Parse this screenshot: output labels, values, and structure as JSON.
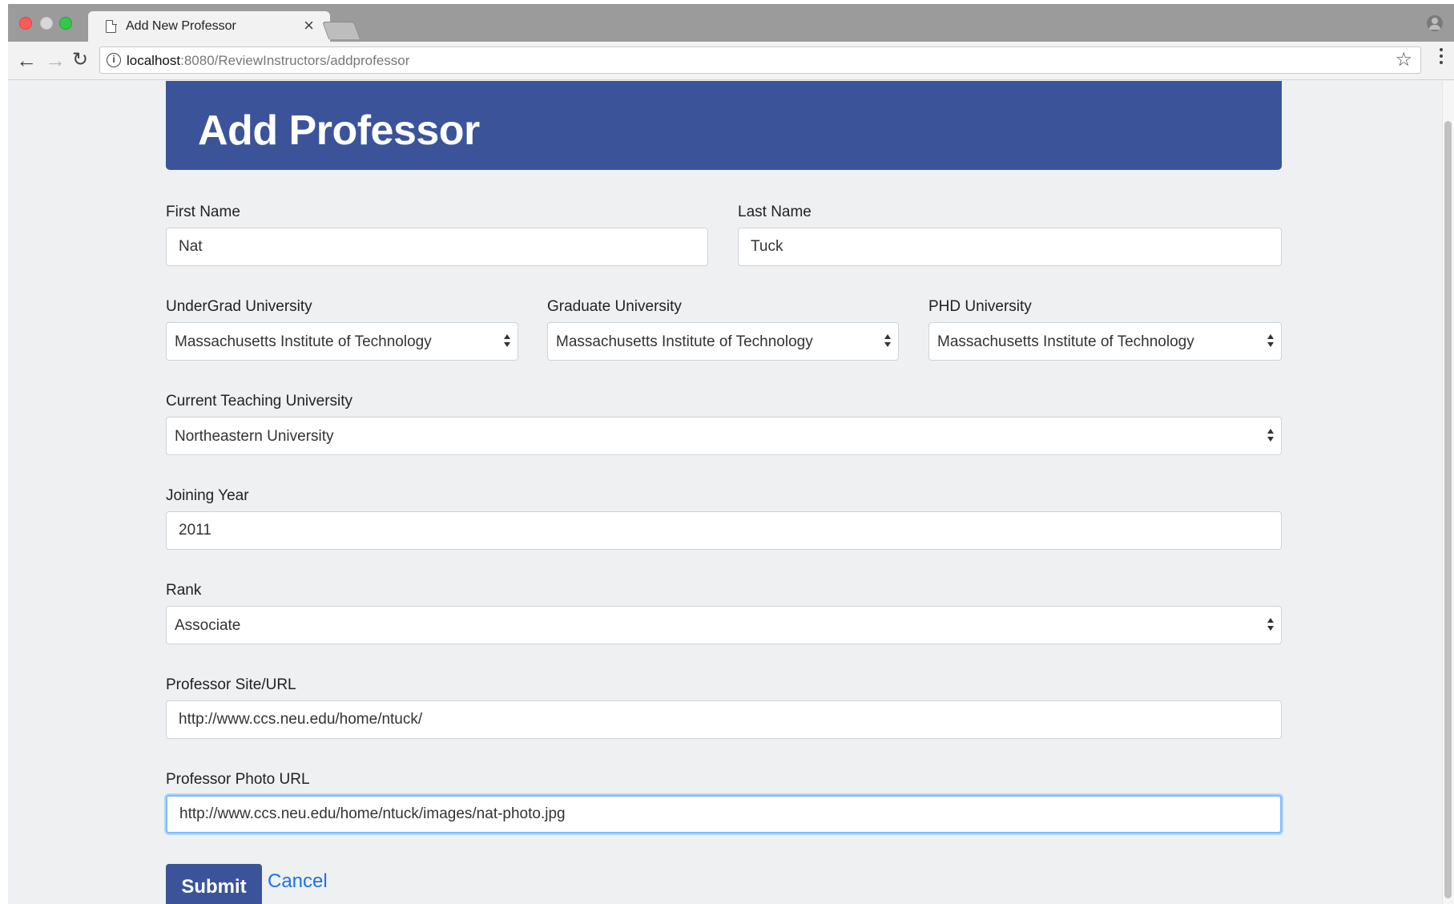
{
  "browser": {
    "tab_title": "Add New Professor",
    "tab_close": "×",
    "url_host": "localhost",
    "url_rest": ":8080/ReviewInstructors/addprofessor"
  },
  "page": {
    "heading": "Add Professor"
  },
  "form": {
    "first_name": {
      "label": "First Name",
      "value": "Nat"
    },
    "last_name": {
      "label": "Last Name",
      "value": "Tuck"
    },
    "undergrad": {
      "label": "UnderGrad University",
      "value": "Massachusetts Institute of Technology"
    },
    "graduate": {
      "label": "Graduate University",
      "value": "Massachusetts Institute of Technology"
    },
    "phd": {
      "label": "PHD University",
      "value": "Massachusetts Institute of Technology"
    },
    "current": {
      "label": "Current Teaching University",
      "value": "Northeastern University"
    },
    "joining_year": {
      "label": "Joining Year",
      "value": "2011"
    },
    "rank": {
      "label": "Rank",
      "value": "Associate"
    },
    "site_url": {
      "label": "Professor Site/URL",
      "value": "http://www.ccs.neu.edu/home/ntuck/"
    },
    "photo_url": {
      "label": "Professor Photo URL",
      "value": "http://www.ccs.neu.edu/home/ntuck/images/nat-photo.jpg"
    },
    "submit_label": "Submit",
    "cancel_label": "Cancel"
  }
}
